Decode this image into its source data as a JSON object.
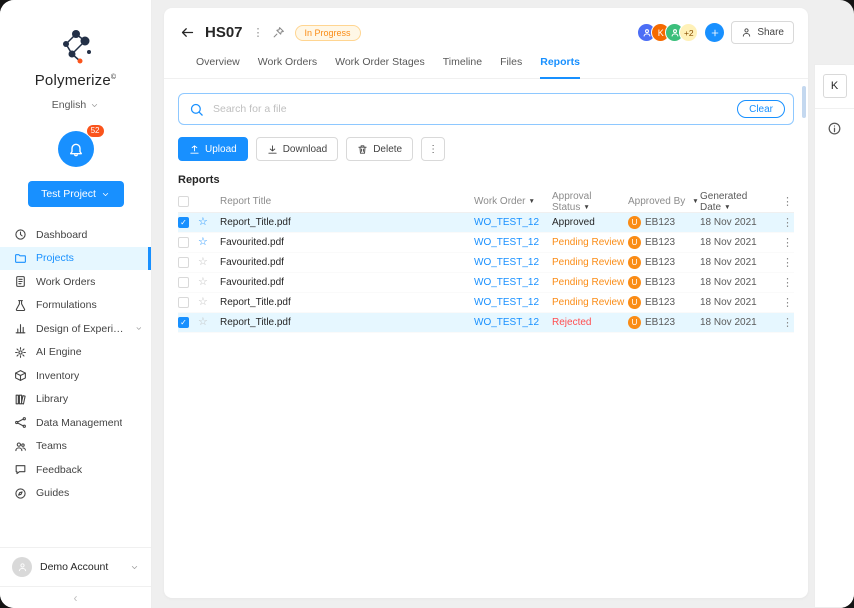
{
  "colors": {
    "primary": "#1890ff",
    "selected_row_bg": "#e6f7ff",
    "pending": "#fa8c16",
    "rejected": "#ff4d4f",
    "approved": "#262626",
    "badge_bg": "#fff7e6",
    "notification_badge": "#fa541c"
  },
  "sidebar": {
    "brand": "Polymerize",
    "brand_mark": "©",
    "language": "English",
    "notifications": "52",
    "project_button": "Test Project",
    "items": [
      {
        "label": "Dashboard",
        "icon": "clock-icon",
        "active": false
      },
      {
        "label": "Projects",
        "icon": "folder-icon",
        "active": true
      },
      {
        "label": "Work Orders",
        "icon": "document-icon",
        "active": false
      },
      {
        "label": "Formulations",
        "icon": "flask-icon",
        "active": false
      },
      {
        "label": "Design of Experiments",
        "icon": "chart-icon",
        "active": false,
        "chevron": true
      },
      {
        "label": "AI Engine",
        "icon": "ai-icon",
        "active": false
      },
      {
        "label": "Inventory",
        "icon": "box-icon",
        "active": false
      },
      {
        "label": "Library",
        "icon": "library-icon",
        "active": false
      },
      {
        "label": "Data Management",
        "icon": "data-icon",
        "active": false
      },
      {
        "label": "Teams",
        "icon": "teams-icon",
        "active": false
      },
      {
        "label": "Feedback",
        "icon": "feedback-icon",
        "active": false
      },
      {
        "label": "Guides",
        "icon": "guides-icon",
        "active": false
      }
    ],
    "account_label": "Demo Account"
  },
  "header": {
    "title": "HS07",
    "status": "In Progress",
    "avatars": [
      {
        "label": "",
        "color": "#4c6ef5"
      },
      {
        "label": "K",
        "color": "#f56a00"
      },
      {
        "label": "",
        "color": "#3cbf7c"
      }
    ],
    "avatar_more": "+2",
    "share_label": "Share"
  },
  "tabs": [
    {
      "label": "Overview",
      "active": false
    },
    {
      "label": "Work Orders",
      "active": false
    },
    {
      "label": "Work Order Stages",
      "active": false
    },
    {
      "label": "Timeline",
      "active": false
    },
    {
      "label": "Files",
      "active": false
    },
    {
      "label": "Reports",
      "active": true
    }
  ],
  "search": {
    "placeholder": "Search for a file",
    "clear_label": "Clear"
  },
  "toolbar": {
    "upload": "Upload",
    "download": "Download",
    "delete": "Delete"
  },
  "reports_title": "Reports",
  "table": {
    "columns": [
      {
        "label": "Report Title",
        "sortable": false
      },
      {
        "label": "Work Order",
        "sortable": true
      },
      {
        "label": "Approval Status",
        "sortable": true
      },
      {
        "label": "Approved By",
        "sortable": true
      },
      {
        "label": "Generated Date",
        "sortable": true
      }
    ],
    "rows": [
      {
        "checked": true,
        "selected": true,
        "star": "blue",
        "title": "Report_Title.pdf",
        "work_order": "WO_TEST_12",
        "status": "Approved",
        "status_type": "approved",
        "approver_initial": "U",
        "approver": "EB123",
        "date": "18 Nov 2021"
      },
      {
        "checked": false,
        "selected": false,
        "star": "blue",
        "title": "Favourited.pdf",
        "work_order": "WO_TEST_12",
        "status": "Pending Review",
        "status_type": "pending",
        "approver_initial": "U",
        "approver": "EB123",
        "date": "18 Nov 2021"
      },
      {
        "checked": false,
        "selected": false,
        "star": "gray",
        "title": "Favourited.pdf",
        "work_order": "WO_TEST_12",
        "status": "Pending Review",
        "status_type": "pending",
        "approver_initial": "U",
        "approver": "EB123",
        "date": "18 Nov 2021"
      },
      {
        "checked": false,
        "selected": false,
        "star": "gray",
        "title": "Favourited.pdf",
        "work_order": "WO_TEST_12",
        "status": "Pending Review",
        "status_type": "pending",
        "approver_initial": "U",
        "approver": "EB123",
        "date": "18 Nov 2021"
      },
      {
        "checked": false,
        "selected": false,
        "star": "gray",
        "title": "Report_Title.pdf",
        "work_order": "WO_TEST_12",
        "status": "Pending Review",
        "status_type": "pending",
        "approver_initial": "U",
        "approver": "EB123",
        "date": "18 Nov 2021"
      },
      {
        "checked": true,
        "selected": true,
        "star": "gray",
        "title": "Report_Title.pdf",
        "work_order": "WO_TEST_12",
        "status": "Rejected",
        "status_type": "rejected",
        "approver_initial": "U",
        "approver": "EB123",
        "date": "18 Nov 2021"
      }
    ]
  },
  "right_rail": {
    "tab_label": "K"
  }
}
